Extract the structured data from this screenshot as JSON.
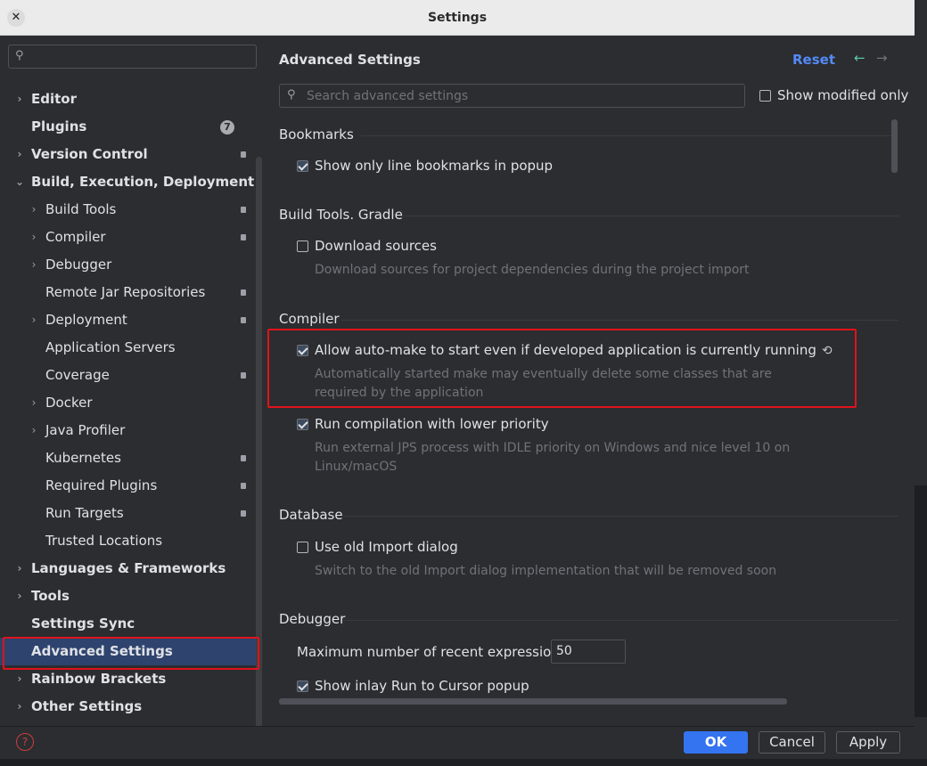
{
  "window": {
    "title": "Settings",
    "close_symbol": "✕"
  },
  "left": {
    "search_value": "",
    "tree": [
      {
        "label": "Editor",
        "level": 0,
        "chevron": "right",
        "bold": true
      },
      {
        "label": "Plugins",
        "level": 0,
        "chevron": "none",
        "bold": true,
        "badge": "7"
      },
      {
        "label": "Version Control",
        "level": 0,
        "chevron": "right",
        "bold": true,
        "mark": true
      },
      {
        "label": "Build, Execution, Deployment",
        "level": 0,
        "chevron": "down",
        "bold": true
      },
      {
        "label": "Build Tools",
        "level": 1,
        "chevron": "right",
        "mark": true
      },
      {
        "label": "Compiler",
        "level": 1,
        "chevron": "right",
        "mark": true
      },
      {
        "label": "Debugger",
        "level": 1,
        "chevron": "right"
      },
      {
        "label": "Remote Jar Repositories",
        "level": 1,
        "chevron": "none",
        "mark": true
      },
      {
        "label": "Deployment",
        "level": 1,
        "chevron": "right",
        "mark": true
      },
      {
        "label": "Application Servers",
        "level": 1,
        "chevron": "none"
      },
      {
        "label": "Coverage",
        "level": 1,
        "chevron": "none",
        "mark": true
      },
      {
        "label": "Docker",
        "level": 1,
        "chevron": "right"
      },
      {
        "label": "Java Profiler",
        "level": 1,
        "chevron": "right"
      },
      {
        "label": "Kubernetes",
        "level": 1,
        "chevron": "none",
        "mark": true
      },
      {
        "label": "Required Plugins",
        "level": 1,
        "chevron": "none",
        "mark": true
      },
      {
        "label": "Run Targets",
        "level": 1,
        "chevron": "none",
        "mark": true
      },
      {
        "label": "Trusted Locations",
        "level": 1,
        "chevron": "none"
      },
      {
        "label": "Languages & Frameworks",
        "level": 0,
        "chevron": "right",
        "bold": true
      },
      {
        "label": "Tools",
        "level": 0,
        "chevron": "right",
        "bold": true
      },
      {
        "label": "Settings Sync",
        "level": 0,
        "chevron": "none",
        "bold": true
      },
      {
        "label": "Advanced Settings",
        "level": 0,
        "chevron": "none",
        "bold": true,
        "selected": true
      },
      {
        "label": "Rainbow Brackets",
        "level": 0,
        "chevron": "right",
        "bold": true
      },
      {
        "label": "Other Settings",
        "level": 0,
        "chevron": "right",
        "bold": true
      }
    ]
  },
  "right": {
    "title": "Advanced Settings",
    "reset_label": "Reset",
    "back_symbol": "←",
    "forward_symbol": "→",
    "search_placeholder": "Search advanced settings",
    "show_modified_label": "Show modified only",
    "show_modified_checked": false,
    "sections": {
      "bookmarks": {
        "title": "Bookmarks",
        "options": [
          {
            "label": "Show only line bookmarks in popup",
            "checked": true
          }
        ]
      },
      "gradle": {
        "title": "Build Tools. Gradle",
        "options": [
          {
            "label": "Download sources",
            "checked": false,
            "desc": "Download sources for project dependencies during the project import"
          }
        ]
      },
      "compiler": {
        "title": "Compiler",
        "options": [
          {
            "label": "Allow auto-make to start even if developed application is currently running",
            "checked": true,
            "desc": "Automatically started make may eventually delete some classes that are required by the application"
          },
          {
            "label": "Run compilation with lower priority",
            "checked": true,
            "desc": "Run external JPS process with IDLE priority on Windows and nice level 10 on Linux/macOS"
          }
        ]
      },
      "database": {
        "title": "Database",
        "options": [
          {
            "label": "Use old Import dialog",
            "checked": false,
            "desc": "Switch to the old Import dialog implementation that will be removed soon"
          }
        ]
      },
      "debugger": {
        "title": "Debugger",
        "recent_expr_label": "Maximum number of recent expressions:",
        "recent_expr_value": "50",
        "options": [
          {
            "label": "Show inlay Run to Cursor popup",
            "checked": true
          }
        ]
      }
    }
  },
  "footer": {
    "help_symbol": "?",
    "ok_label": "OK",
    "cancel_label": "Cancel",
    "apply_label": "Apply"
  },
  "colors": {
    "accent": "#3574f0",
    "link": "#548af7",
    "highlight_outline": "#e0131b",
    "selection": "#2e436e",
    "panel": "#2b2d30"
  },
  "icons": {
    "search": "search-icon",
    "reset_option": "reset-arrow-icon",
    "help": "help-icon"
  }
}
